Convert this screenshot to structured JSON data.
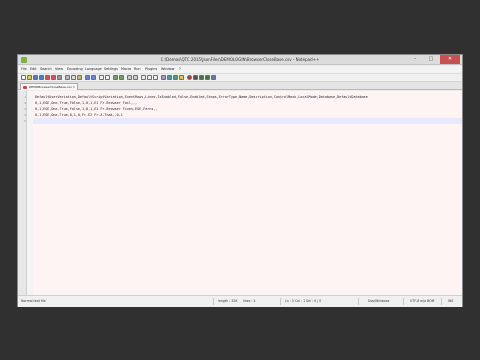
{
  "window": {
    "title": "C:\\Demos\\QTC 2015\\JsonFiles\\DEMOLOGIN\\BrowserCloseBase.csv - Notepad++",
    "minimize_glyph": "–",
    "maximize_glyph": "□",
    "close_glyph": "✕"
  },
  "menu": {
    "items": [
      "File",
      "Edit",
      "Search",
      "View",
      "Encoding",
      "Language",
      "Settings",
      "Macro",
      "Run",
      "Plugins",
      "Window",
      "?"
    ]
  },
  "tab": {
    "label": "DEMOBrowserCloseBase.csv",
    "close_glyph": "✕"
  },
  "editor": {
    "lines": [
      {
        "num": "1",
        "text": "DefaultUserVariation,DefaultScriptVariation,EventRows,Lines,IsEnabled,False,Enabled,Steps,ErrorType,Name,Description,ControlMask,LocalMode,Database,DefaultDatabase"
      },
      {
        "num": "2",
        "text": "0,1,EGE,One,True,False,1,0,1,E1 Fr.Browser Fail,,,"
      },
      {
        "num": "3",
        "text": "0,1,EGE,One,True,False,1,0,1,E1 Fr.Browser Fixes,EGE,Ferns,,"
      },
      {
        "num": "4",
        "text": "0,1,EGE,One,True,0,1,0,Fr.E2 Fr.A.Thak,,0,1"
      },
      {
        "num": "5",
        "text": ""
      }
    ]
  },
  "status": {
    "file_type": "Normal text file",
    "length": "length : 328",
    "lines": "lines : 4",
    "position": "Ln : 5   Col : 1   Sel : 0 | 0",
    "line_endings": "Dos\\Windows",
    "encoding": "UTF-8 w/o BOM",
    "insert_mode": "INS"
  },
  "colors": {
    "editor_background": "#fff4f4",
    "current_line": "#e8e8ff",
    "close_button": "#c75050"
  },
  "toolbar": {
    "icons": [
      "new-file-icon",
      "open-file-icon",
      "save-icon",
      "save-all-icon",
      "close-icon",
      "close-all-icon",
      "print-icon",
      "cut-icon",
      "copy-icon",
      "paste-icon",
      "undo-icon",
      "redo-icon",
      "find-icon",
      "replace-icon",
      "zoom-in-icon",
      "zoom-out-icon",
      "sync-v-icon",
      "sync-h-icon",
      "wrap-icon",
      "all-chars-icon",
      "indent-guide-icon",
      "udl-icon",
      "doc-map-icon",
      "function-list-icon",
      "folder-workspace-icon",
      "record-macro-icon",
      "stop-macro-icon",
      "play-macro-icon",
      "run-macro-multi-icon",
      "save-macro-icon"
    ]
  }
}
